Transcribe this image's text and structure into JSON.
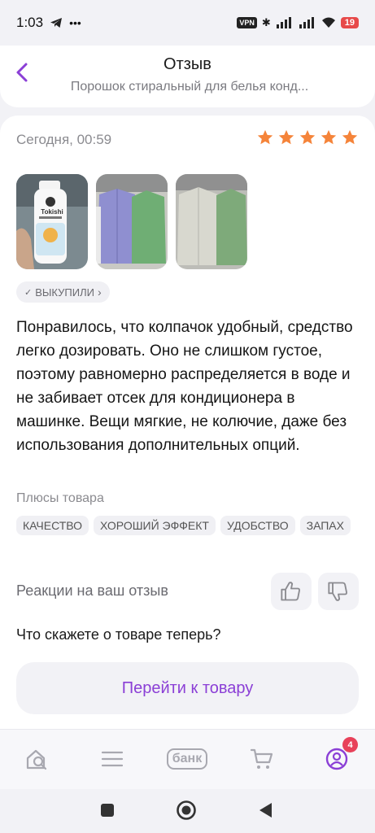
{
  "status_bar": {
    "time": "1:03",
    "battery": "19",
    "vpn": "VPN"
  },
  "header": {
    "title": "Отзыв",
    "subtitle": "Порошок стиральный для белья конд..."
  },
  "review": {
    "date": "Сегодня, 00:59",
    "rating": 5,
    "badge": "ВЫКУПИЛИ",
    "text": "Понравилось, что колпачок удобный, средство легко дозировать. Оно не слишком густое, поэтому равномерно распределяется в воде и не забивает отсек для кондиционера в машинке. Вещи мягкие, не колючие, даже без использования дополнительных опций.",
    "pros_label": "Плюсы товара",
    "tags": [
      "КАЧЕСТВО",
      "ХОРОШИЙ ЭФФЕКТ",
      "УДОБСТВО",
      "ЗАПАХ"
    ],
    "bottle_brand": "Tokishi",
    "reactions_label": "Реакции на ваш отзыв",
    "cut_text": "Что скажете о товаре теперь?"
  },
  "goto_button": "Перейти к товару",
  "nav": {
    "bank_label": "банк",
    "profile_badge": "4"
  },
  "colors": {
    "accent": "#8b3fd6",
    "star": "#f5843a",
    "badge_red": "#e8415a"
  }
}
